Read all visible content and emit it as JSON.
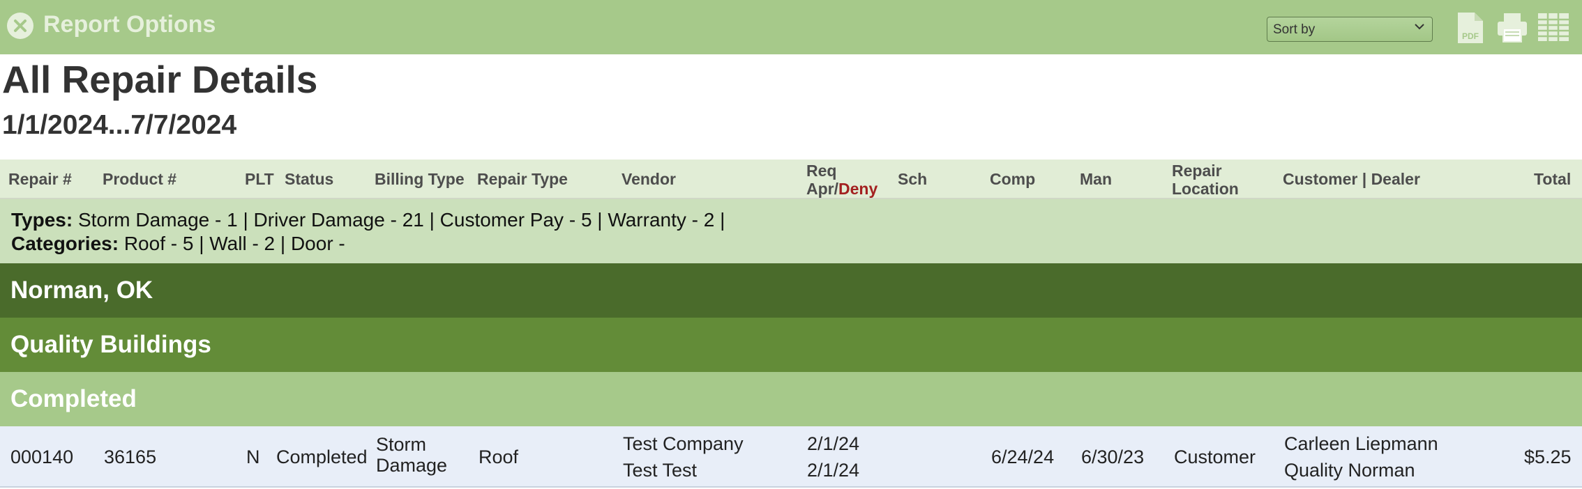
{
  "toolbar": {
    "title": "Report Options",
    "sort_placeholder": "Sort by",
    "icons": [
      "close-circle-icon",
      "pdf-icon",
      "print-icon",
      "table-icon"
    ]
  },
  "report": {
    "title": "All Repair Details",
    "date_range": "1/1/2024...7/7/2024"
  },
  "columns": {
    "repair_num": "Repair #",
    "product_num": "Product #",
    "plt": "PLT",
    "status": "Status",
    "billing_type": "Billing Type",
    "repair_type": "Repair Type",
    "vendor": "Vendor",
    "req_line1": "Req",
    "req_apr": "Apr/",
    "req_deny": "Deny",
    "sch": "Sch",
    "comp": "Comp",
    "man": "Man",
    "repair_location_line1": "Repair",
    "repair_location_line2": "Location",
    "customer_dealer": "Customer | Dealer",
    "total": "Total"
  },
  "summary": {
    "types_label": "Types:",
    "types_value": "Storm Damage - 1 | Driver Damage - 21 | Customer Pay - 5 | Warranty - 2 |",
    "categories_label": "Categories:",
    "categories_value": "Roof - 5 | Wall - 2 | Door -"
  },
  "groups": {
    "location": "Norman, OK",
    "dealer": "Quality Buildings",
    "status": "Completed"
  },
  "rows": [
    {
      "repair_num": "000140",
      "product_num": "36165",
      "plt": "N",
      "status": "Completed",
      "billing_type_line1": "Storm",
      "billing_type_line2": "Damage",
      "repair_type": "Roof",
      "vendor_line1": "Test Company",
      "vendor_line2": "Test Test",
      "req_line1": "2/1/24",
      "req_line2": "2/1/24",
      "sch": "",
      "comp": "6/24/24",
      "man": "6/30/23",
      "repair_location": "Customer",
      "customer": "Carleen Liepmann",
      "dealer": "Quality Norman",
      "total": "$5.25"
    }
  ],
  "colors": {
    "toolbar_bg": "#a6c98a",
    "header_bg": "#e1edd6",
    "summary_bg": "#cbe0bb",
    "band_location": "#4a6b2b",
    "band_dealer": "#638c38",
    "band_status": "#a6c98a",
    "row_bg": "#e8eef8",
    "deny_red": "#a32020"
  }
}
